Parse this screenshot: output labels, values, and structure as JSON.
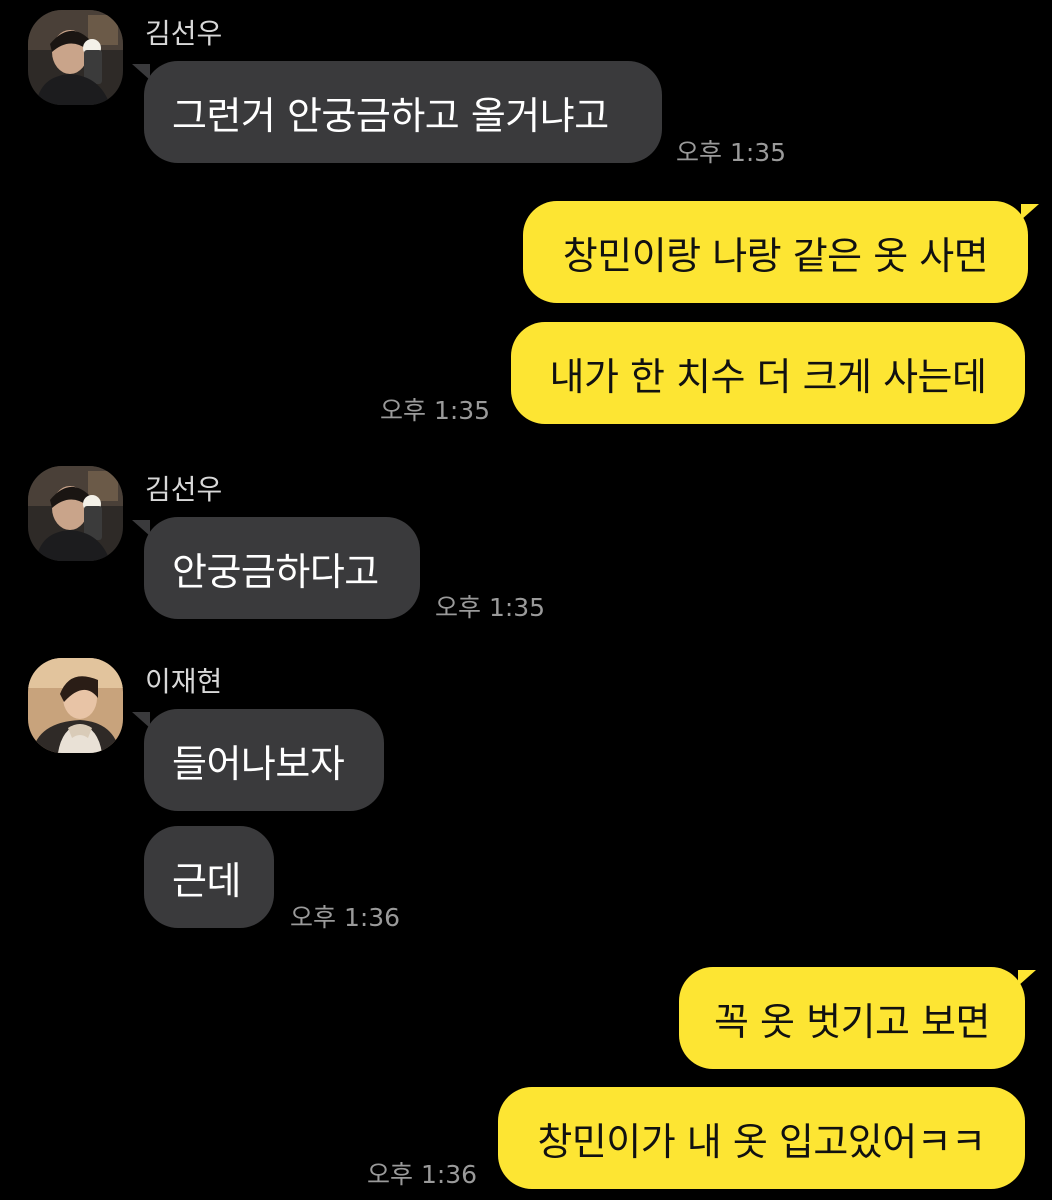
{
  "messages": [
    {
      "id": "m1",
      "direction": "incoming",
      "sender": "김선우",
      "avatar": "avatar-kim-seonwoo-icon",
      "bubbles": [
        "그런거 안궁금하고 올거냐고"
      ],
      "time": "오후 1:35"
    },
    {
      "id": "m2",
      "direction": "outgoing",
      "bubbles": [
        "창민이랑 나랑 같은 옷 사면",
        "내가 한 치수 더 크게 사는데"
      ],
      "time": "오후 1:35"
    },
    {
      "id": "m3",
      "direction": "incoming",
      "sender": "김선우",
      "avatar": "avatar-kim-seonwoo-icon",
      "bubbles": [
        "안궁금하다고"
      ],
      "time": "오후 1:35"
    },
    {
      "id": "m4",
      "direction": "incoming",
      "sender": "이재현",
      "avatar": "avatar-lee-jaehyun-icon",
      "bubbles": [
        "들어나보자",
        "근데"
      ],
      "time": "오후 1:36"
    },
    {
      "id": "m5",
      "direction": "outgoing",
      "bubbles": [
        "꼭 옷 벗기고 보면",
        "창민이가 내 옷 입고있어ㅋㅋ"
      ],
      "time": "오후 1:36"
    }
  ],
  "colors": {
    "background": "#000000",
    "incoming_bubble": "#3a3a3c",
    "outgoing_bubble": "#fde533",
    "timestamp": "#9a9a9a"
  }
}
